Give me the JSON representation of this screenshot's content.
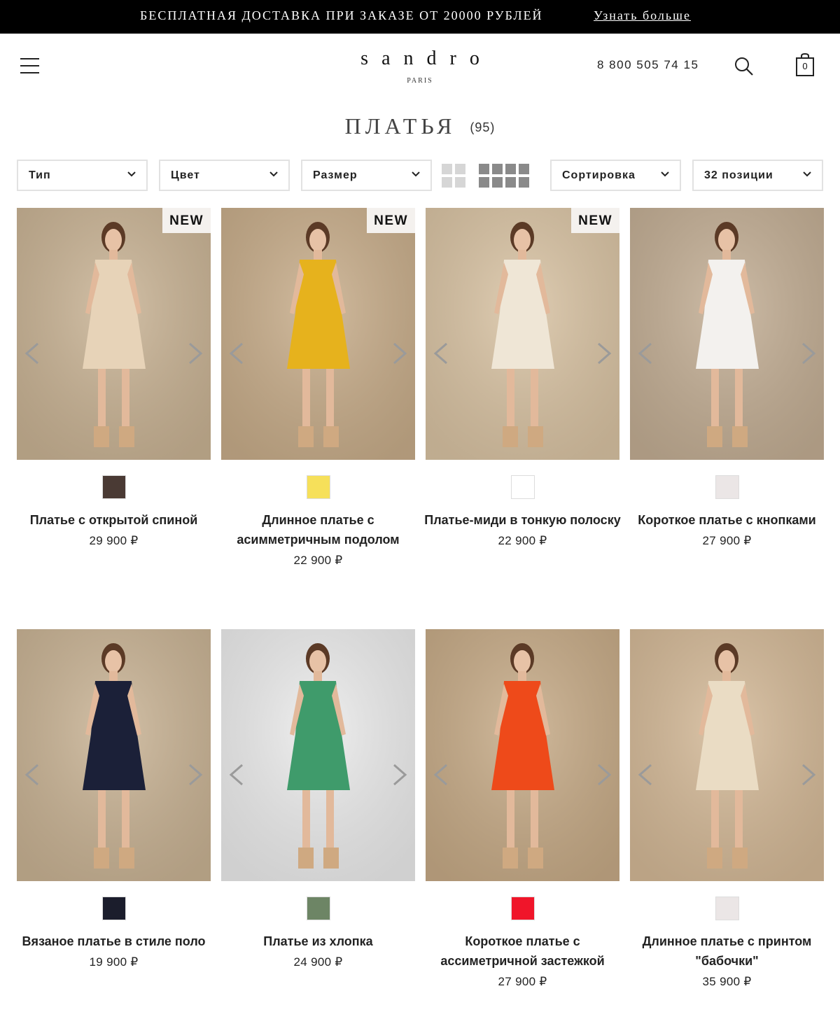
{
  "promo": {
    "text": "БЕСПЛАТНАЯ ДОСТАВКА ПРИ ЗАКАЗЕ ОТ 20000 РУБЛЕЙ",
    "link": "Узнать больше"
  },
  "header": {
    "logo": "sandro",
    "logo_sub": "PARIS",
    "phone": "8 800 505 74 15",
    "cart_count": "0",
    "icons": [
      "menu-icon",
      "search-icon",
      "cart-icon"
    ]
  },
  "page": {
    "title": "ПЛАТЬЯ",
    "count": "(95)"
  },
  "filters": {
    "type": "Тип",
    "color": "Цвет",
    "size": "Размер",
    "sort": "Сортировка",
    "per_page": "32 позиции"
  },
  "colors": {
    "promo_bg": "#000000",
    "photo_bg": "#c9b394",
    "view_active": "#8a8a8a",
    "view_inactive": "#d6d6d6"
  },
  "products": [
    {
      "name": "Платье с открытой спиной",
      "price": "29 900 ₽",
      "badge": "NEW",
      "swatch": "#4a3a34",
      "dress": "#e7d3b8",
      "bg": "#c9b394"
    },
    {
      "name": "Длинное платье с асимметричным подолом",
      "price": "22 900 ₽",
      "badge": "NEW",
      "swatch": "#f6e05a",
      "dress": "#e6b21d",
      "bg": "#c8ad8a"
    },
    {
      "name": "Платье-миди в тонкую полоску",
      "price": "22 900 ₽",
      "badge": "NEW",
      "swatch": "#ffffff",
      "dress": "#efe6d6",
      "bg": "#d9c3a3"
    },
    {
      "name": "Короткое платье с кнопками",
      "price": "27 900 ₽",
      "badge": "",
      "swatch": "#ebe6e6",
      "dress": "#f3f1ee",
      "bg": "#c3ae94"
    },
    {
      "name": "Вязаное платье в стиле поло",
      "price": "19 900 ₽",
      "badge": "",
      "swatch": "#1b1d2c",
      "dress": "#1b2038",
      "bg": "#c9b394"
    },
    {
      "name": "Платье из хлопка",
      "price": "24 900 ₽",
      "badge": "",
      "swatch": "#6d8565",
      "dress": "#3f9b6b",
      "bg": "#ececec"
    },
    {
      "name": "Короткое платье с ассиметричной застежкой",
      "price": "27 900 ₽",
      "badge": "",
      "swatch": "#f0152a",
      "dress": "#ee4a1a",
      "bg": "#c7ab87"
    },
    {
      "name": "Длинное платье с принтом \"бабочки\"",
      "price": "35 900 ₽",
      "badge": "",
      "swatch": "#ebe6e6",
      "dress": "#eadcc4",
      "bg": "#d4b997"
    }
  ]
}
